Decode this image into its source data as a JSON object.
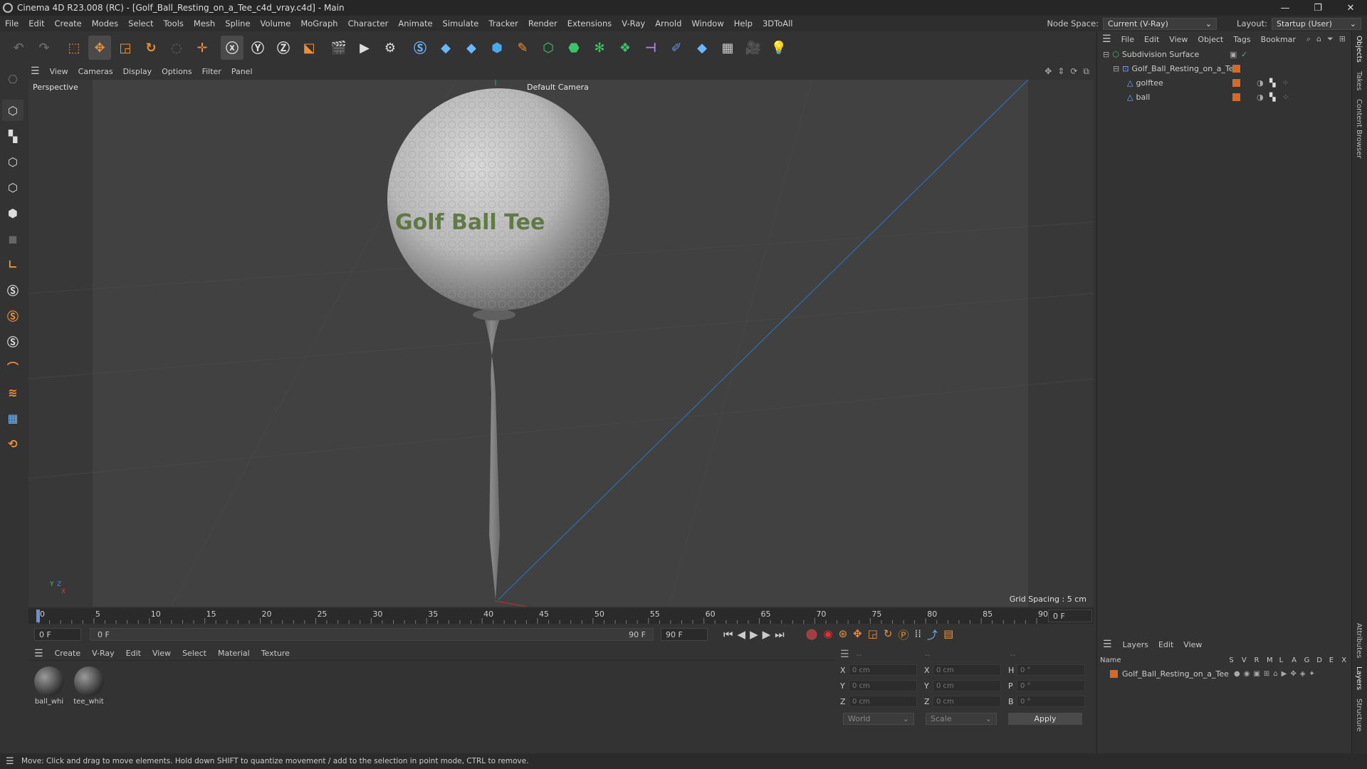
{
  "window": {
    "title": "Cinema 4D R23.008 (RC) - [Golf_Ball_Resting_on_a_Tee_c4d_vray.c4d] - Main",
    "controls": [
      "—",
      "❐",
      "✕"
    ]
  },
  "menubar": {
    "items": [
      "File",
      "Edit",
      "Create",
      "Modes",
      "Select",
      "Tools",
      "Mesh",
      "Spline",
      "Volume",
      "MoGraph",
      "Character",
      "Animate",
      "Simulate",
      "Tracker",
      "Render",
      "Extensions",
      "V-Ray",
      "Arnold",
      "Window",
      "Help",
      "3DToAll"
    ],
    "node_space_label": "Node Space:",
    "node_space_value": "Current (V-Ray)",
    "layout_label": "Layout:",
    "layout_value": "Startup (User)"
  },
  "toolbar": {
    "icons": [
      "undo-icon",
      "redo-icon",
      "select-icon",
      "move-icon",
      "scale-icon",
      "rotate-icon",
      "lasso-icon",
      "add-icon",
      "x-axis-icon",
      "y-axis-icon",
      "z-axis-icon",
      "coord-icon",
      "render-region-icon",
      "render-view-icon",
      "render-settings-icon",
      "vray-icon",
      "python-icon",
      "python2-icon",
      "cube-icon",
      "pen-icon",
      "subdiv-icon",
      "extrude-icon",
      "array-icon",
      "mograph-icon",
      "deformer-icon",
      "spline-icon",
      "python3-icon",
      "floor-icon",
      "camera-icon",
      "light-icon"
    ]
  },
  "viewport": {
    "menu": [
      "View",
      "Cameras",
      "Display",
      "Options",
      "Filter",
      "Panel"
    ],
    "label": "Perspective",
    "camera": "Default Camera",
    "grid_spacing": "Grid Spacing : 5 cm",
    "ball_logo": "Golf Ball Tee"
  },
  "timeline": {
    "ticks": [
      "0",
      "5",
      "10",
      "15",
      "20",
      "25",
      "30",
      "35",
      "40",
      "45",
      "50",
      "55",
      "60",
      "65",
      "70",
      "75",
      "80",
      "85",
      "90"
    ],
    "current_frame": "0 F",
    "start": "0 F",
    "range_start": "0 F",
    "range_end": "90 F",
    "end": "90 F"
  },
  "material_panel": {
    "menu": [
      "Create",
      "V-Ray",
      "Edit",
      "View",
      "Select",
      "Material",
      "Texture"
    ],
    "materials": [
      "ball_whi",
      "tee_whit"
    ]
  },
  "coords": {
    "header": [
      "--",
      "--",
      "--"
    ],
    "rows": [
      {
        "a": "X",
        "v1": "0 cm",
        "b": "X",
        "v2": "0 cm",
        "c": "H",
        "v3": "0 °"
      },
      {
        "a": "Y",
        "v1": "0 cm",
        "b": "Y",
        "v2": "0 cm",
        "c": "P",
        "v3": "0 °"
      },
      {
        "a": "Z",
        "v1": "0 cm",
        "b": "Z",
        "v2": "0 cm",
        "c": "B",
        "v3": "0 °"
      }
    ],
    "world": "World",
    "scale": "Scale",
    "apply": "Apply"
  },
  "object_manager": {
    "menu": [
      "File",
      "Edit",
      "View",
      "Object",
      "Tags",
      "Bookmar"
    ],
    "objects": [
      {
        "name": "Subdivision Surface",
        "indent": 0
      },
      {
        "name": "Golf_Ball_Resting_on_a_Tee",
        "indent": 1
      },
      {
        "name": "golftee",
        "indent": 2
      },
      {
        "name": "ball",
        "indent": 2
      }
    ]
  },
  "layers": {
    "menu": [
      "Layers",
      "Edit",
      "View"
    ],
    "columns": [
      "Name",
      "S",
      "V",
      "R",
      "M",
      "L",
      "A",
      "G",
      "D",
      "E",
      "X"
    ],
    "rows": [
      "Golf_Ball_Resting_on_a_Tee"
    ]
  },
  "side_tabs": [
    "Objects",
    "Takes",
    "Content Browser",
    "Attributes",
    "Layers",
    "Structure"
  ],
  "status": "Move: Click and drag to move elements. Hold down SHIFT to quantize movement / add to the selection in point mode, CTRL to remove.",
  "colors": {
    "accent": "#d46a2a",
    "axis_line": "#2d6fb0",
    "bg": "#333333"
  }
}
